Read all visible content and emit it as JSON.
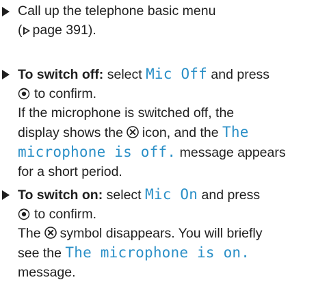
{
  "steps": [
    {
      "lines": [
        {
          "text": "Call up the telephone basic menu"
        },
        {
          "open": "(",
          "ref": "page 391",
          "close": ")."
        }
      ]
    },
    {
      "label": "To switch off:",
      "select": "select",
      "item": "Mic Off",
      "and_press": "and press",
      "confirm": "to confirm.",
      "note_line1": "If the microphone is switched off, the",
      "note_line2_pre": "display shows the",
      "note_line2_post": "icon, and the",
      "message_part1": "The",
      "message_part2": "microphone is off.",
      "message_after": "message appears",
      "note_line4": "for a short period."
    },
    {
      "label": "To switch on:",
      "select": "select",
      "item": "Mic On",
      "and_press": "and press",
      "confirm": "to confirm.",
      "note_line1_pre": "The",
      "note_line1_post": "symbol disappears. You will briefly",
      "note_line2_pre": "see the",
      "message": "The microphone is on.",
      "note_line3": "message."
    }
  ],
  "icons": {
    "bullet": "triangle-bullet-icon",
    "reference": "page-reference-triangle-icon",
    "controller": "rotary-controller-icon",
    "mic_off": "microphone-off-icon"
  },
  "colors": {
    "text": "#1f1f1f",
    "display_text": "#2a8fc7"
  }
}
